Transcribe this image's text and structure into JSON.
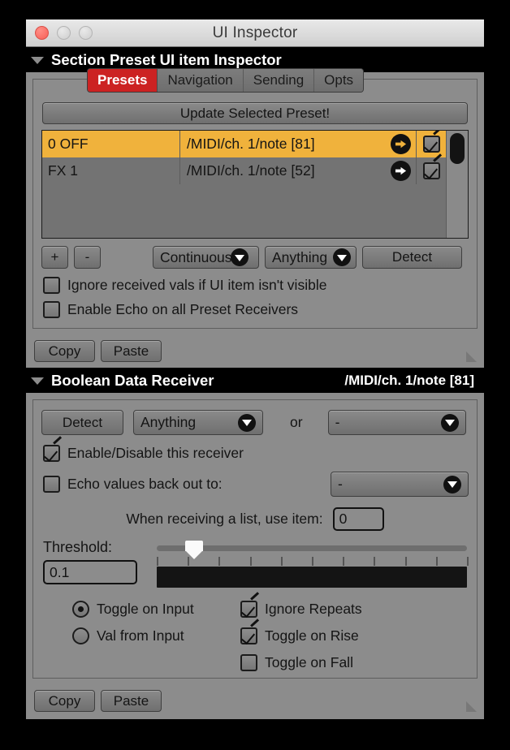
{
  "window": {
    "title": "UI Inspector",
    "lights": [
      "close",
      "minimize",
      "zoom"
    ]
  },
  "section1": {
    "title": "Section Preset UI item Inspector",
    "tabs": [
      {
        "label": "Presets",
        "active": true
      },
      {
        "label": "Navigation",
        "active": false
      },
      {
        "label": "Sending",
        "active": false
      },
      {
        "label": "Opts",
        "active": false
      }
    ],
    "update_button": "Update Selected Preset!",
    "list": {
      "rows": [
        {
          "name": "0 OFF",
          "address": "/MIDI/ch. 1/note [81]",
          "enabled": true,
          "selected": true
        },
        {
          "name": "FX 1",
          "address": "/MIDI/ch. 1/note [52]",
          "enabled": true,
          "selected": false
        }
      ]
    },
    "controls": {
      "add_label": "+",
      "remove_label": "-",
      "mode_dropdown": "Continuous",
      "type_dropdown": "Anything",
      "detect_label": "Detect"
    },
    "options": [
      {
        "label": "Ignore received vals if UI item isn't visible",
        "checked": false
      },
      {
        "label": "Enable Echo on all Preset Receivers",
        "checked": false
      }
    ],
    "footer": {
      "copy": "Copy",
      "paste": "Paste"
    }
  },
  "section2": {
    "title": "Boolean Data Receiver",
    "address": "/MIDI/ch. 1/note [81]",
    "detect_label": "Detect",
    "type_dropdown": "Anything",
    "or_label": "or",
    "or_dropdown": "-",
    "enable_receiver": {
      "label": "Enable/Disable this receiver",
      "checked": true
    },
    "echo": {
      "label": "Echo values back out to:",
      "checked": false,
      "dropdown": "-"
    },
    "list_item": {
      "label": "When receiving a list, use item:",
      "value": "0"
    },
    "threshold": {
      "label": "Threshold:",
      "value": "0.1",
      "slider_position_pct": 12,
      "tick_count": 11
    },
    "radios": [
      {
        "label": "Toggle on Input",
        "checked": true
      },
      {
        "label": "Val from Input",
        "checked": false
      }
    ],
    "checks": [
      {
        "label": "Ignore Repeats",
        "checked": true
      },
      {
        "label": "Toggle on Rise",
        "checked": true
      },
      {
        "label": "Toggle on Fall",
        "checked": false
      }
    ],
    "footer": {
      "copy": "Copy",
      "paste": "Paste"
    }
  },
  "colors": {
    "panel": "#8c8c8c",
    "list_bg": "#737373",
    "selection": "#f0b23c",
    "accent_tab": "#cc2222",
    "header_bg": "#000000"
  }
}
